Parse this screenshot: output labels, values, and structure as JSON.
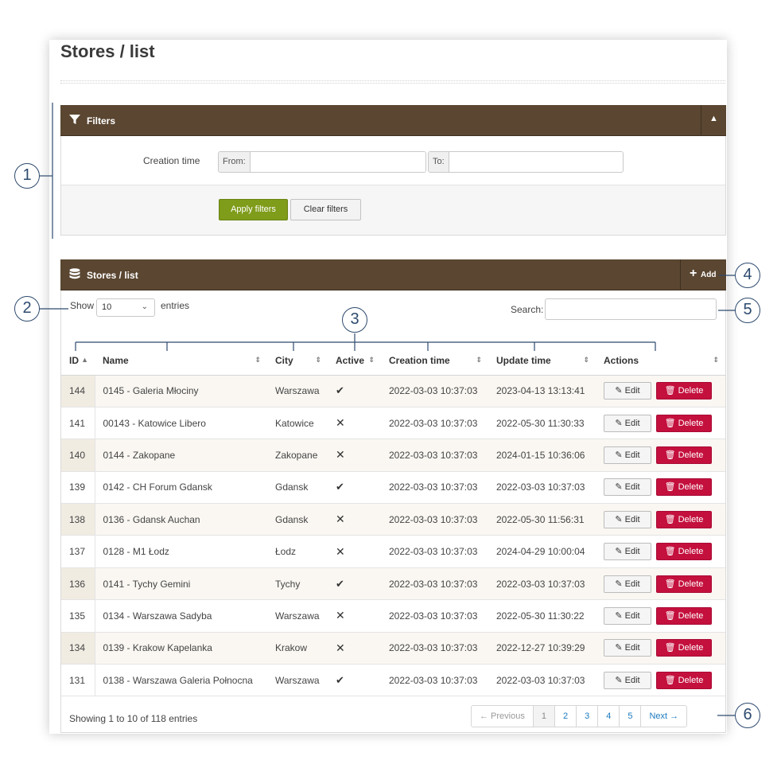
{
  "page": {
    "title": "Stores / list"
  },
  "filters": {
    "header": "Filters",
    "creation_label": "Creation time",
    "from_label": "From:",
    "to_label": "To:",
    "apply_label": "Apply filters",
    "clear_label": "Clear filters"
  },
  "list": {
    "header": "Stores / list",
    "add_label": "Add",
    "show_label": "Show",
    "page_size": "10",
    "entries_label": "entries",
    "search_label": "Search:",
    "columns": [
      "ID",
      "Name",
      "City",
      "Active",
      "Creation time",
      "Update time",
      "Actions"
    ],
    "rows": [
      {
        "id": "144",
        "name": "0145 - Galeria Młociny",
        "city": "Warszawa",
        "active": true,
        "created": "2022-03-03 10:37:03",
        "updated": "2023-04-13 13:13:41"
      },
      {
        "id": "141",
        "name": "00143 - Katowice Libero",
        "city": "Katowice",
        "active": false,
        "created": "2022-03-03 10:37:03",
        "updated": "2022-05-30 11:30:33"
      },
      {
        "id": "140",
        "name": "0144 - Zakopane",
        "city": "Zakopane",
        "active": false,
        "created": "2022-03-03 10:37:03",
        "updated": "2024-01-15 10:36:06"
      },
      {
        "id": "139",
        "name": "0142 - CH Forum Gdansk",
        "city": "Gdansk",
        "active": true,
        "created": "2022-03-03 10:37:03",
        "updated": "2022-03-03 10:37:03"
      },
      {
        "id": "138",
        "name": "0136 - Gdansk Auchan",
        "city": "Gdansk",
        "active": false,
        "created": "2022-03-03 10:37:03",
        "updated": "2022-05-30 11:56:31"
      },
      {
        "id": "137",
        "name": "0128 - M1 Łodz",
        "city": "Łodz",
        "active": false,
        "created": "2022-03-03 10:37:03",
        "updated": "2024-04-29 10:00:04"
      },
      {
        "id": "136",
        "name": "0141 - Tychy Gemini",
        "city": "Tychy",
        "active": true,
        "created": "2022-03-03 10:37:03",
        "updated": "2022-03-03 10:37:03"
      },
      {
        "id": "135",
        "name": "0134 - Warszawa Sadyba",
        "city": "Warszawa",
        "active": false,
        "created": "2022-03-03 10:37:03",
        "updated": "2022-05-30 11:30:22"
      },
      {
        "id": "134",
        "name": "0139 - Krakow Kapelanka",
        "city": "Krakow",
        "active": false,
        "created": "2022-03-03 10:37:03",
        "updated": "2022-12-27 10:39:29"
      },
      {
        "id": "131",
        "name": "0138 - Warszawa Galeria Połnocna",
        "city": "Warszawa",
        "active": true,
        "created": "2022-03-03 10:37:03",
        "updated": "2022-03-03 10:37:03"
      }
    ],
    "edit_label": "Edit",
    "delete_label": "Delete",
    "showing_text": "Showing 1 to 10 of 118 entries",
    "pager": {
      "prev": "← Previous",
      "pages": [
        "1",
        "2",
        "3",
        "4",
        "5"
      ],
      "current": "1",
      "next": "Next →"
    }
  },
  "callouts": [
    "1",
    "2",
    "3",
    "4",
    "5",
    "6"
  ],
  "colors": {
    "header_bg": "#5a4631",
    "apply_bg": "#7f9c1a",
    "delete_bg": "#c4103d",
    "callout": "#2d4a6e"
  },
  "icons": {
    "filter": "funnel-icon",
    "list": "database-icon",
    "toggle": "sort-toggle-icon",
    "add": "plus-icon",
    "edit": "pencil-icon",
    "delete": "trash-icon"
  }
}
